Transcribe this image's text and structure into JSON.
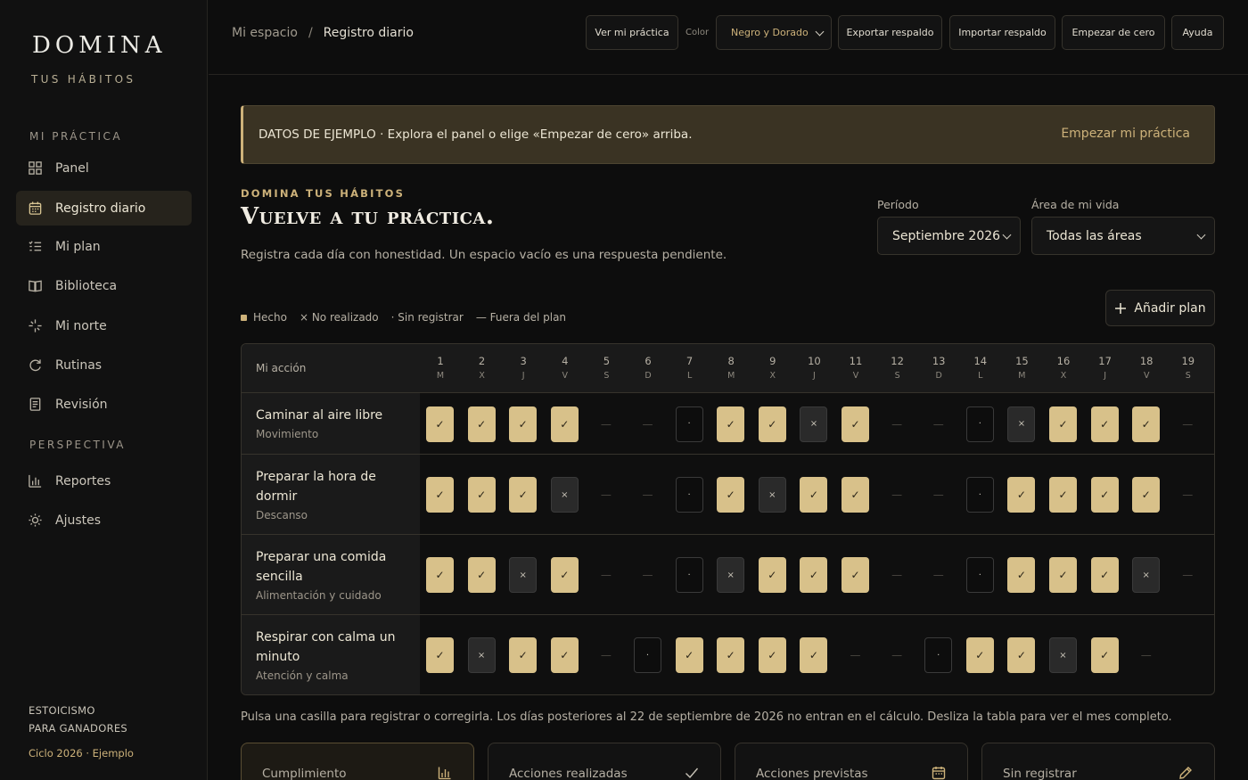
{
  "brand": {
    "name": "DOMINA",
    "tagline": "TUS HÁBITOS"
  },
  "sidebar": {
    "section_practice": "MI PRÁCTICA",
    "section_perspective": "PERSPECTIVA",
    "items": [
      {
        "label": "Panel",
        "icon": "grid-icon"
      },
      {
        "label": "Registro diario",
        "icon": "calendar-icon"
      },
      {
        "label": "Mi plan",
        "icon": "list-icon"
      },
      {
        "label": "Biblioteca",
        "icon": "book-icon"
      },
      {
        "label": "Mi norte",
        "icon": "compass-icon"
      },
      {
        "label": "Rutinas",
        "icon": "refresh-icon"
      },
      {
        "label": "Revisión",
        "icon": "document-icon"
      },
      {
        "label": "Reportes",
        "icon": "bar-chart-icon"
      },
      {
        "label": "Ajustes",
        "icon": "sun-icon"
      }
    ],
    "footer_line1": "ESTOICISMO",
    "footer_line2": "PARA GANADORES",
    "footer_cycle": "Ciclo 2026 · Ejemplo"
  },
  "topbar": {
    "crumb_root": "Mi espacio",
    "crumb_sep": "/",
    "crumb_current": "Registro diario",
    "view_practice": "Ver mi práctica",
    "color_label": "Color",
    "color_value": "Negro y Dorado",
    "export": "Exportar respaldo",
    "import": "Importar respaldo",
    "reset": "Empezar de cero",
    "help": "Ayuda"
  },
  "banner": {
    "text": "DATOS DE EJEMPLO · Explora el panel o elige «Empezar de cero» arriba.",
    "link": "Empezar mi práctica"
  },
  "header": {
    "eyebrow": "DOMINA TUS HÁBITOS",
    "title": "Vuelve a tu práctica.",
    "subtitle": "Registra cada día con honestidad. Un espacio vacío es una respuesta pendiente."
  },
  "filters": {
    "period_label": "Período",
    "period_value": "Septiembre 2026",
    "area_label": "Área de mi vida",
    "area_value": "Todas las áreas"
  },
  "legend": {
    "done": "Hecho",
    "missed": "× No realizado",
    "empty": "· Sin registrar",
    "off": "— Fuera del plan"
  },
  "add_plan": "Añadir plan",
  "table": {
    "action_header": "Mi acción",
    "days": [
      {
        "n": "1",
        "w": "M"
      },
      {
        "n": "2",
        "w": "X"
      },
      {
        "n": "3",
        "w": "J"
      },
      {
        "n": "4",
        "w": "V"
      },
      {
        "n": "5",
        "w": "S"
      },
      {
        "n": "6",
        "w": "D"
      },
      {
        "n": "7",
        "w": "L"
      },
      {
        "n": "8",
        "w": "M"
      },
      {
        "n": "9",
        "w": "X"
      },
      {
        "n": "10",
        "w": "J"
      },
      {
        "n": "11",
        "w": "V"
      },
      {
        "n": "12",
        "w": "S"
      },
      {
        "n": "13",
        "w": "D"
      },
      {
        "n": "14",
        "w": "L"
      },
      {
        "n": "15",
        "w": "M"
      },
      {
        "n": "16",
        "w": "X"
      },
      {
        "n": "17",
        "w": "J"
      },
      {
        "n": "18",
        "w": "V"
      },
      {
        "n": "19",
        "w": "S"
      }
    ],
    "rows": [
      {
        "name": "Caminar al aire libre",
        "area": "Movimiento",
        "cells": [
          "done",
          "done",
          "done",
          "done",
          "off",
          "off",
          "empty",
          "done",
          "done",
          "miss",
          "done",
          "off",
          "off",
          "empty",
          "miss",
          "done",
          "done",
          "done",
          "off"
        ]
      },
      {
        "name": "Preparar la hora de dormir",
        "area": "Descanso",
        "cells": [
          "done",
          "done",
          "done",
          "miss",
          "off",
          "off",
          "empty",
          "done",
          "miss",
          "done",
          "done",
          "off",
          "off",
          "empty",
          "done",
          "done",
          "done",
          "done",
          "off"
        ]
      },
      {
        "name": "Preparar una comida sencilla",
        "area": "Alimentación y cuidado",
        "cells": [
          "done",
          "done",
          "miss",
          "done",
          "off",
          "off",
          "empty",
          "miss",
          "done",
          "done",
          "done",
          "off",
          "off",
          "empty",
          "done",
          "done",
          "done",
          "miss",
          "off"
        ]
      },
      {
        "name": "Respirar con calma un minuto",
        "area": "Atención y calma",
        "cells": [
          "done",
          "miss",
          "done",
          "done",
          "off",
          "empty",
          "done",
          "done",
          "done",
          "done",
          "off",
          "off",
          "empty",
          "done",
          "done",
          "miss",
          "done",
          "off"
        ]
      }
    ],
    "glyphs": {
      "done": "✓",
      "miss": "×",
      "empty": "·",
      "off": "—"
    }
  },
  "note": "Pulsa una casilla para registrar o corregirla. Los días posteriores al 22 de septiembre de 2026 no entran en el cálculo. Desliza la tabla para ver el mes completo.",
  "stats": [
    {
      "label": "Cumplimiento",
      "icon": "bar-chart-icon"
    },
    {
      "label": "Acciones realizadas",
      "icon": "check-icon"
    },
    {
      "label": "Acciones previstas",
      "icon": "calendar-icon"
    },
    {
      "label": "Sin registrar",
      "icon": "pencil-icon"
    }
  ],
  "colors": {
    "accent": "#cdb27a",
    "done_cell": "#d8c18a",
    "background": "#0d0d0d"
  }
}
